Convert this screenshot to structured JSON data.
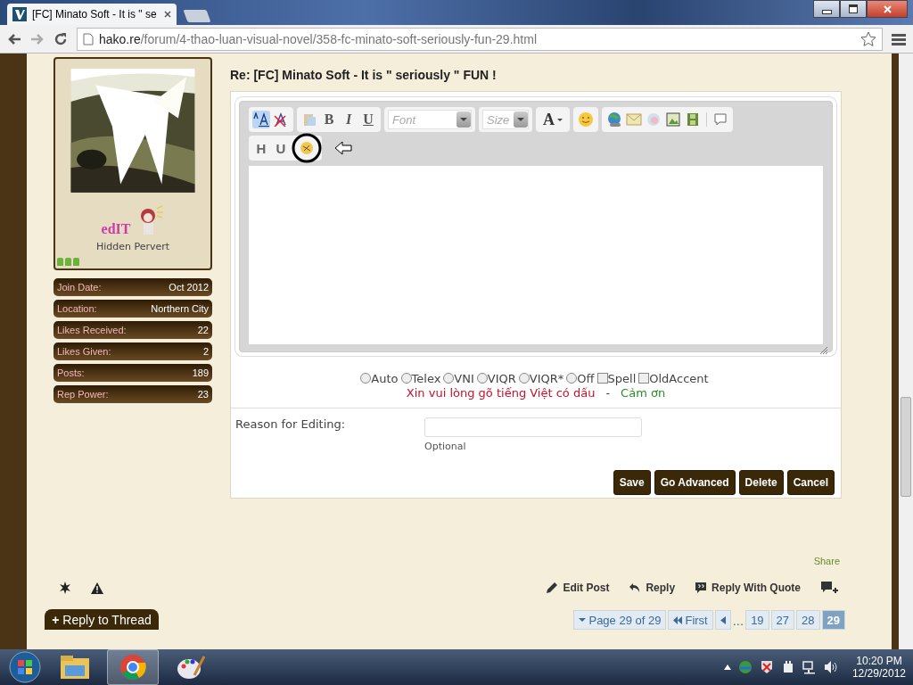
{
  "browser": {
    "tab_title": "[FC] Minato Soft - It is \" se",
    "url_host": "hako.re",
    "url_path": "/forum/4-thao-luan-visual-novel/358-fc-minato-soft-seriously-fun-29.html"
  },
  "profile": {
    "username": "edIT",
    "user_title": "Hidden Pervert",
    "stats": [
      {
        "label": "Join Date:",
        "value": "Oct 2012"
      },
      {
        "label": "Location:",
        "value": "Northern City"
      },
      {
        "label": "Likes Received:",
        "value": "22"
      },
      {
        "label": "Likes Given:",
        "value": "2"
      },
      {
        "label": "Posts:",
        "value": "189"
      },
      {
        "label": "Rep Power:",
        "value": "23"
      }
    ]
  },
  "post": {
    "title": "Re: [FC] Minato Soft - It is \" seriously \" FUN !",
    "toolbar": {
      "format_buttons": [
        "B",
        "I",
        "U"
      ],
      "font": {
        "placeholder": "Font"
      },
      "size": {
        "placeholder": "Size"
      },
      "color_button": "A",
      "row2_buttons": [
        "H",
        "U"
      ]
    },
    "input_methods": [
      {
        "label": "Auto",
        "kind": "radio",
        "checked": false
      },
      {
        "label": "Telex",
        "kind": "radio",
        "checked": false
      },
      {
        "label": "VNI",
        "kind": "radio",
        "checked": false
      },
      {
        "label": "VIQR",
        "kind": "radio",
        "checked": false
      },
      {
        "label": "VIQR*",
        "kind": "radio",
        "checked": false
      },
      {
        "label": "Off",
        "kind": "radio",
        "checked": false
      },
      {
        "label": "Spell",
        "kind": "checkbox",
        "checked": false
      },
      {
        "label": "OldAccent",
        "kind": "checkbox",
        "checked": false
      }
    ],
    "notice": {
      "text": "Xin vui lòng gõ tiếng Việt có dấu",
      "separator": "-",
      "thanks": "Cảm ơn"
    },
    "reason": {
      "label": "Reason for Editing:",
      "hint": "Optional"
    },
    "buttons": [
      "Save",
      "Go Advanced",
      "Delete",
      "Cancel"
    ]
  },
  "footer": {
    "share": "Share",
    "actions": [
      "Edit Post",
      "Reply",
      "Reply With Quote"
    ],
    "reply_to_thread": {
      "icon": "+",
      "label": "Reply to Thread"
    },
    "pagination": {
      "page_info": "Page 29 of 29",
      "first": "First",
      "ellipsis": "...",
      "pages": [
        {
          "label": "19",
          "selected": false
        },
        {
          "label": "27",
          "selected": false
        },
        {
          "label": "28",
          "selected": false
        },
        {
          "label": "29",
          "selected": true
        }
      ]
    }
  },
  "taskbar": {
    "time": "10:20 PM",
    "date": "12/29/2012"
  }
}
